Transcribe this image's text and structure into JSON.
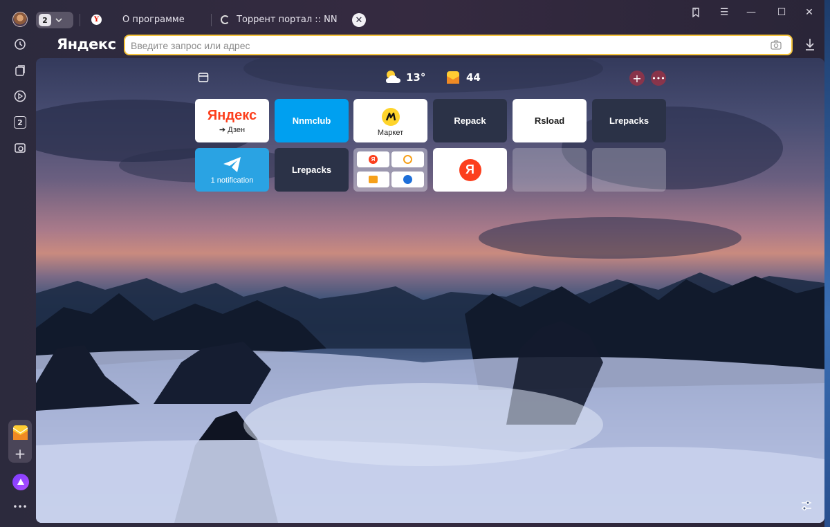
{
  "tabbar": {
    "tab_count": "2",
    "tabs": [
      {
        "label": "О программе",
        "active": false
      },
      {
        "label": "Торрент портал :: NNM-Cl",
        "loading": true
      }
    ],
    "close_symbol": "✕"
  },
  "window_controls": {
    "bookmarks": "bookmark-icon",
    "menu": "☰",
    "minimize": "—",
    "maximize": "☐",
    "close": "✕"
  },
  "sidebar": {
    "items": [
      "history-icon",
      "collections-icon",
      "video-icon",
      "tabs-counter-icon",
      "screenshot-icon"
    ],
    "tabs_badge": "2",
    "bottom": [
      "mail-icon",
      "add-icon",
      "alice-icon",
      "more-icon"
    ],
    "more_label": "•••"
  },
  "address_bar": {
    "logo": "Яндекс",
    "placeholder": "Введите запрос или адрес",
    "value": ""
  },
  "widgets": {
    "weather_temp": "13°",
    "mail_count": "44"
  },
  "tiles": {
    "row1": [
      {
        "label_logo": "Яндекс",
        "label_sub": "➔ Дзен",
        "style": "white"
      },
      {
        "label": "Nnmclub",
        "style": "blue"
      },
      {
        "label": "Маркет",
        "style": "white"
      },
      {
        "label": "Repack",
        "style": "dark"
      },
      {
        "label": "Rsload",
        "style": "white"
      },
      {
        "label": "Lrepacks",
        "style": "dark"
      }
    ],
    "row2": [
      {
        "label": "1 notification",
        "style": "telegram"
      },
      {
        "label": "Lrepacks",
        "style": "dark"
      },
      {
        "label": "",
        "style": "group"
      },
      {
        "label": "",
        "style": "yandex-round"
      },
      {
        "label": "",
        "style": "empty"
      },
      {
        "label": "",
        "style": "empty"
      }
    ]
  },
  "colors": {
    "accent_yellow": "#f6c43c",
    "yandex_red": "#fc3f1d",
    "telegram_blue": "#2aa3e3",
    "nnmclub_blue": "#00a0f0",
    "tile_dark": "#2b3247"
  }
}
